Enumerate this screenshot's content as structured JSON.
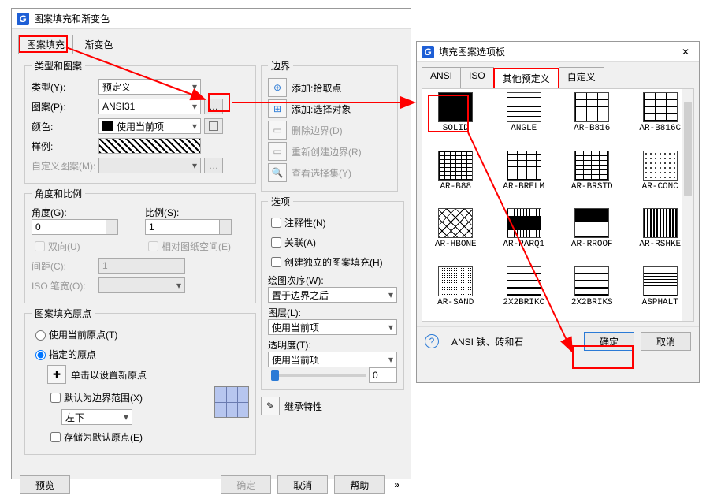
{
  "main": {
    "title": "图案填充和渐变色",
    "tabs": [
      "图案填充",
      "渐变色"
    ],
    "group_type": "类型和图案",
    "lbl_type": "类型(Y):",
    "val_type": "预定义",
    "lbl_pattern": "图案(P):",
    "val_pattern": "ANSI31",
    "lbl_color": "颜色:",
    "val_color": "使用当前项",
    "lbl_sample": "样例:",
    "lbl_custom": "自定义图案(M):",
    "group_angle": "角度和比例",
    "lbl_angle": "角度(G):",
    "val_angle": "0",
    "lbl_scale": "比例(S):",
    "val_scale": "1",
    "chk_double": "双向(U)",
    "chk_paper": "相对图纸空间(E)",
    "lbl_gap": "间距(C):",
    "val_gap": "1",
    "lbl_iso": "ISO 笔宽(O):",
    "group_origin": "图案填充原点",
    "radio_cur": "使用当前原点(T)",
    "radio_spec": "指定的原点",
    "chk_click": "单击以设置新原点",
    "chk_default_ext": "默认为边界范围(X)",
    "val_pos": "左下",
    "chk_store": "存储为默认原点(E)",
    "btn_preview": "预览",
    "btn_ok": "确定",
    "btn_cancel": "取消",
    "btn_help": "帮助"
  },
  "right": {
    "group_border": "边界",
    "add_pick": "添加:拾取点",
    "add_sel": "添加:选择对象",
    "del_border": "删除边界(D)",
    "recreate": "重新创建边界(R)",
    "view_sel": "查看选择集(Y)",
    "group_opts": "选项",
    "chk_annot": "注释性(N)",
    "chk_assoc": "关联(A)",
    "chk_indep": "创建独立的图案填充(H)",
    "lbl_draworder": "绘图次序(W):",
    "val_draworder": "置于边界之后",
    "lbl_layer": "图层(L):",
    "val_layer": "使用当前项",
    "lbl_trans": "透明度(T):",
    "val_trans": "使用当前项",
    "val_slider": "0",
    "chk_inherit": "继承特性"
  },
  "palette": {
    "title": "填充图案选项板",
    "tabs": [
      "ANSI",
      "ISO",
      "其他预定义",
      "自定义"
    ],
    "items": [
      "SOLID",
      "ANGLE",
      "AR-B816",
      "AR-B816C",
      "AR-B88",
      "AR-BRELM",
      "AR-BRSTD",
      "AR-CONC",
      "AR-HBONE",
      "AR-PARQ1",
      "AR-RROOF",
      "AR-RSHKE",
      "AR-SAND",
      "2X2BRIKC",
      "2X2BRIKS",
      "ASPHALT"
    ],
    "status": "ANSI 铁、砖和石",
    "btn_ok": "确定",
    "btn_cancel": "取消"
  }
}
